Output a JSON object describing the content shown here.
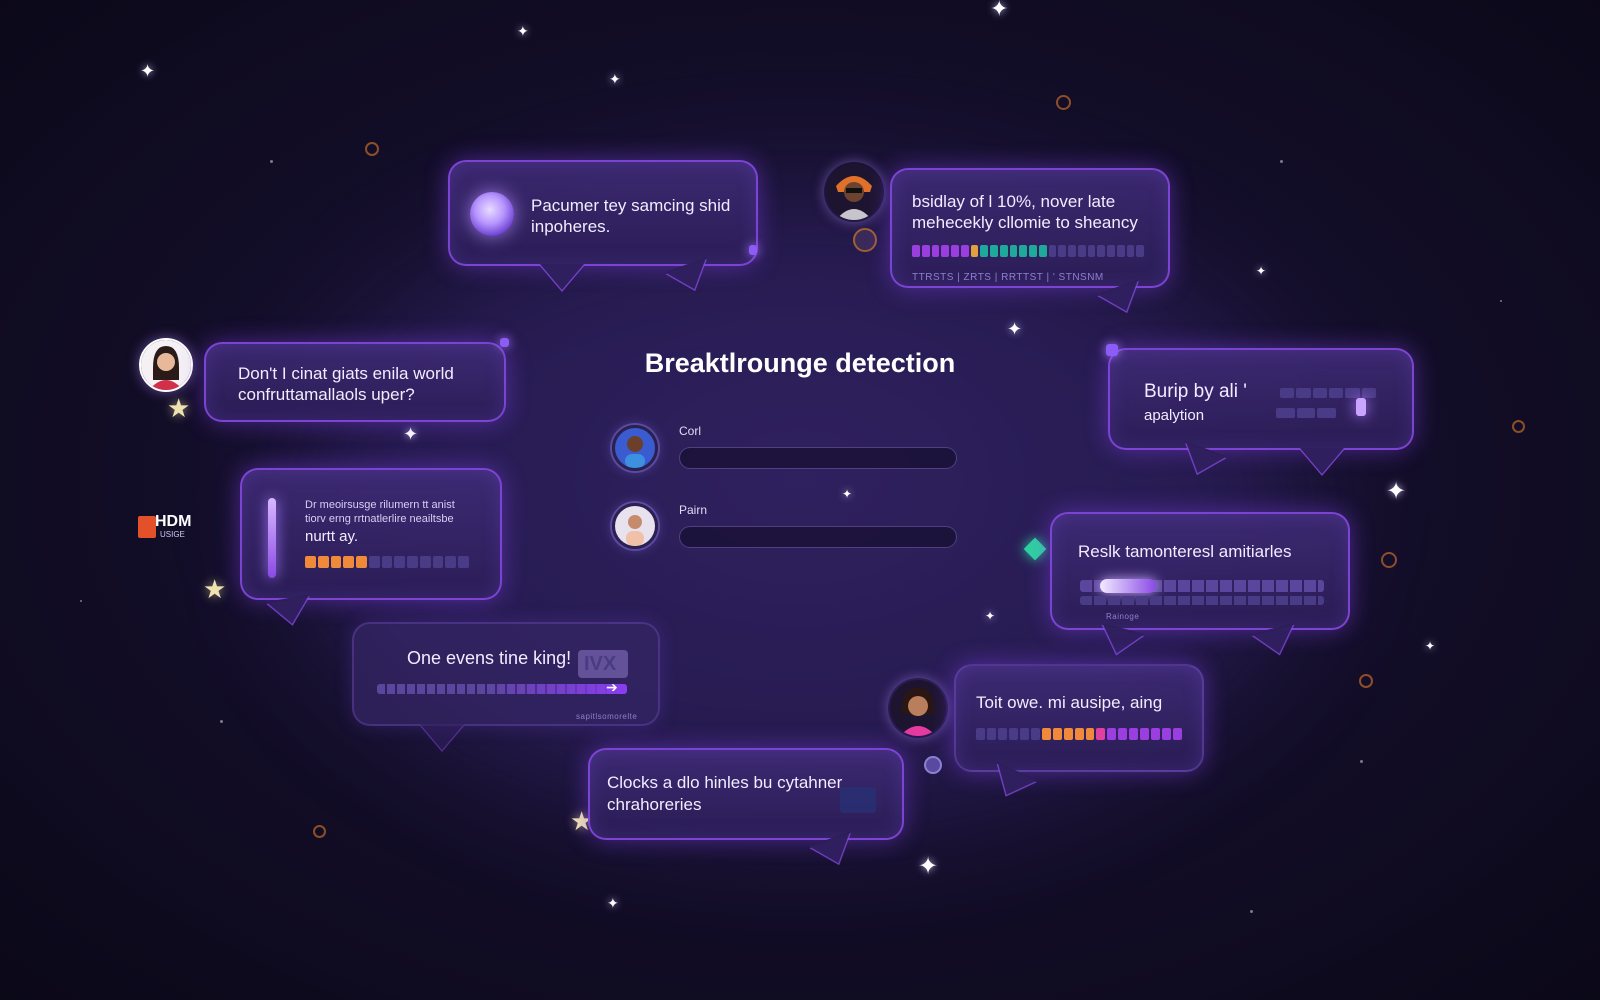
{
  "title": "Breaktlrounge detection",
  "form": {
    "field1_label": "Corl",
    "field2_label": "Pairn"
  },
  "logo": {
    "line1": "HDM",
    "line2": "USIGE"
  },
  "bubbles": {
    "b1": {
      "line1": "Pacumer tey samcing shid",
      "line2": "inpoheres."
    },
    "b2": {
      "line1": "bsidlay of l 10%, nover late",
      "line2": "mehecekly cllomie to sheancy",
      "footer": "TTRSTS | ZRTS | RRTTST | ' STNSNM"
    },
    "b3": {
      "line1": "Don't I cinat giats enila world",
      "line2": "confruttamallaols uper?"
    },
    "b4": {
      "line1": "Burip by ali '",
      "line2": "apalytion"
    },
    "b5": {
      "line1": "Dr meoirsusge rilumern tt anist",
      "line2": "tiorv erng rrtnatlerlire neailtsbe",
      "line3": "nurtt ay."
    },
    "b6": {
      "line1": "Reslk tamonteresl amitiarles",
      "footer": "Rainoge"
    },
    "b7": {
      "line1": "One evens tine king!",
      "badge": "IVX",
      "footer": "sapitlsomorelte"
    },
    "b8": {
      "line1": "Toit owe. mi ausipe, aing"
    },
    "b9": {
      "line1": "Clocks a dlo hinles bu cytahner",
      "line2": "chrahoreries"
    }
  },
  "colors": {
    "background": "#120d26",
    "bubble_border": "#8a4ae6",
    "accent_purple": "#9b5cf6",
    "accent_orange": "#f08a3a",
    "accent_teal": "#1ea99a",
    "accent_pink": "#e040a0"
  },
  "icons": {
    "orb": "orb-icon",
    "pin": "pin-icon",
    "gem": "gem-icon",
    "star": "star-icon"
  }
}
